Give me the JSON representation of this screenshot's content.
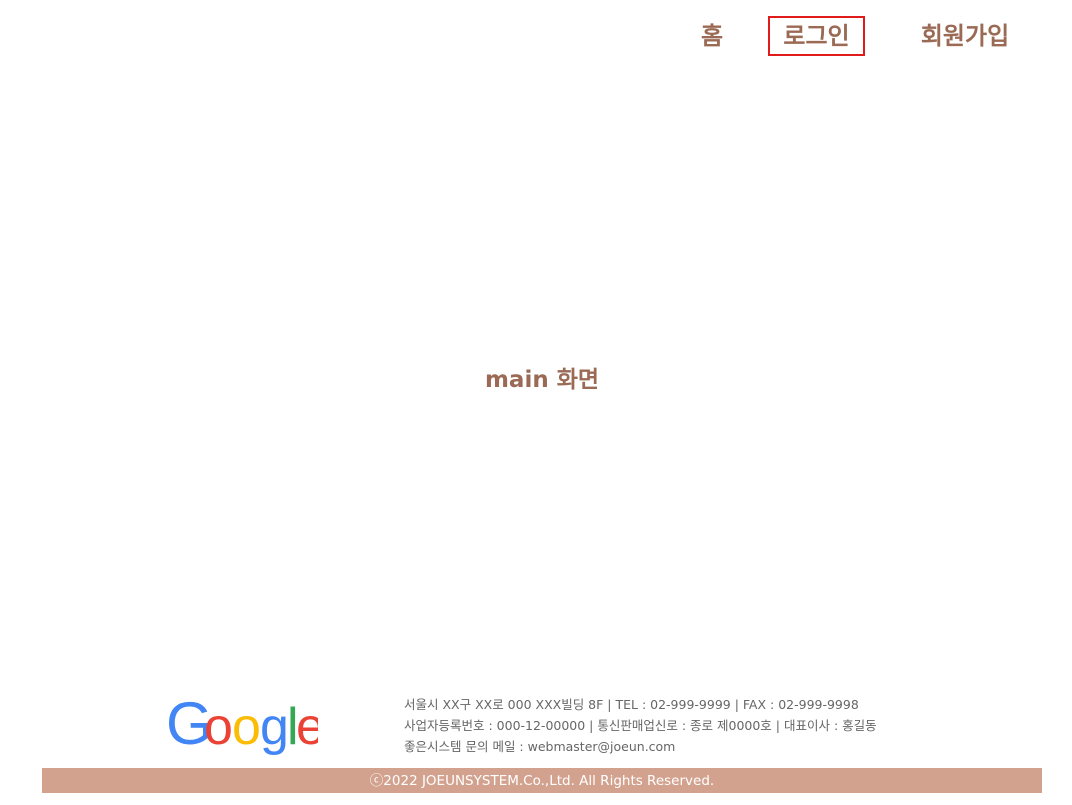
{
  "nav": {
    "home_label": "홈",
    "login_label": "로그인",
    "signup_label": "회원가입",
    "text_color": "#9b6a55",
    "highlight_color": "#e01b1b"
  },
  "main": {
    "title": "main 화면"
  },
  "footer": {
    "logo": {
      "name": "google-logo",
      "letters": [
        "G",
        "o",
        "o",
        "g",
        "l",
        "e"
      ],
      "colors": [
        "#4285F4",
        "#EA4335",
        "#FBBC05",
        "#4285F4",
        "#34A853",
        "#EA4335"
      ]
    },
    "info_lines": [
      "서울시 XX구 XX로 000 XXX빌딩 8F | TEL : 02-999-9999 | FAX : 02-999-9998",
      "사업자등록번호 : 000-12-00000 | 통신판매업신로 : 종로 제0000호 | 대표이사 : 홍길동",
      "좋은시스템 문의 메일 : webmaster@joeun.com"
    ],
    "copyright": "ⓒ2022 JOEUNSYSTEM.Co.,Ltd. All Rights Reserved.",
    "bar_color": "#d3a28e"
  }
}
